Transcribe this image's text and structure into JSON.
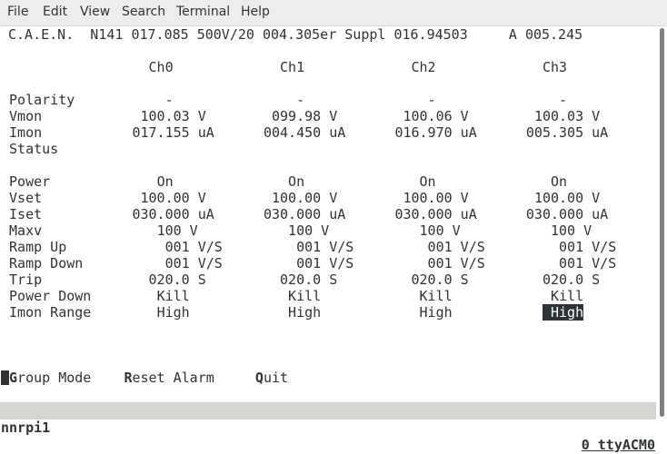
{
  "menu": [
    "File",
    "Edit",
    "View",
    "Search",
    "Terminal",
    "Help"
  ],
  "header_line": "C.A.E.N.  N141 017.085 500V/20 004.305er Suppl 016.94503     A 005.245",
  "channels": [
    "Ch0",
    "Ch1",
    "Ch2",
    "Ch3"
  ],
  "rows": [
    {
      "label": "Polarity",
      "values": [
        "-",
        "-",
        "-",
        "-"
      ]
    },
    {
      "label": "Vmon",
      "values": [
        "100.03 V",
        "099.98 V",
        "100.06 V",
        "100.03 V"
      ]
    },
    {
      "label": "Imon",
      "values": [
        "017.155 uA",
        "004.450 uA",
        "016.970 uA",
        "005.305 uA"
      ]
    },
    {
      "label": "Status",
      "values": [
        "",
        "",
        "",
        ""
      ]
    },
    {
      "label": "",
      "values": [
        "",
        "",
        "",
        ""
      ]
    },
    {
      "label": "Power",
      "values": [
        "On",
        "On",
        "On",
        "On"
      ]
    },
    {
      "label": "Vset",
      "values": [
        "100.00 V",
        "100.00 V",
        "100.00 V",
        "100.00 V"
      ]
    },
    {
      "label": "Iset",
      "values": [
        "030.000 uA",
        "030.000 uA",
        "030.000 uA",
        "030.000 uA"
      ]
    },
    {
      "label": "Maxv",
      "values": [
        "100 V",
        "100 V",
        "100 V",
        "100 V"
      ]
    },
    {
      "label": "Ramp Up",
      "values": [
        "001 V/S",
        "001 V/S",
        "001 V/S",
        "001 V/S"
      ]
    },
    {
      "label": "Ramp Down",
      "values": [
        "001 V/S",
        "001 V/S",
        "001 V/S",
        "001 V/S"
      ]
    },
    {
      "label": "Trip",
      "values": [
        "020.0 S",
        "020.0 S",
        "020.0 S",
        "020.0 S"
      ]
    },
    {
      "label": "Power Down",
      "values": [
        "Kill",
        "Kill",
        "Kill",
        "Kill"
      ]
    },
    {
      "label": "Imon Range",
      "values": [
        "High",
        "High",
        "High",
        "High"
      ]
    }
  ],
  "commands": [
    {
      "key": "G",
      "rest": "roup Mode"
    },
    {
      "key": "R",
      "rest": "eset Alarm"
    },
    {
      "key": "Q",
      "rest": "uit"
    }
  ],
  "status": {
    "left": "nnrpi1",
    "right": "0 ttyACM0"
  },
  "colors": {
    "fg": "#2e3436",
    "statusbar": "#d3d7cf",
    "menubar": "#ededed"
  }
}
